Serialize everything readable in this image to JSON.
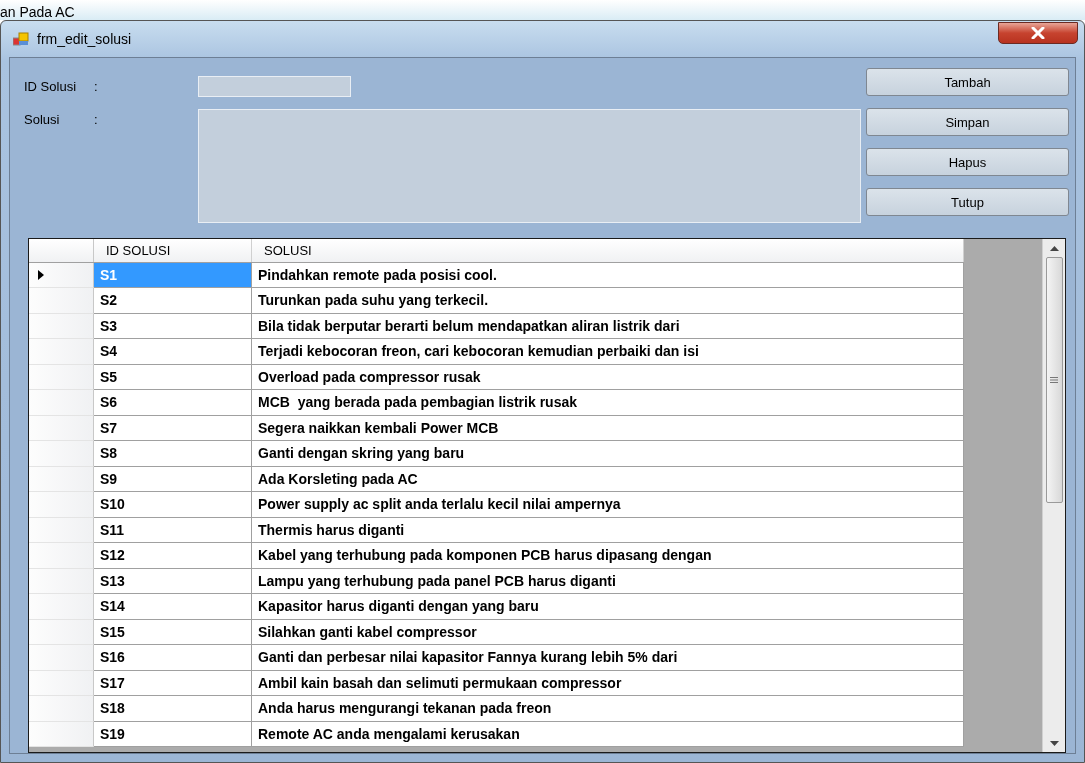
{
  "background_window": {
    "title": "an Pada AC"
  },
  "window": {
    "title": "frm_edit_solusi"
  },
  "form": {
    "fields": [
      {
        "label": "ID Solusi",
        "separator": ":",
        "kind": "text"
      },
      {
        "label": "Solusi",
        "separator": ":",
        "kind": "textarea"
      }
    ]
  },
  "buttons": [
    "Tambah",
    "Simpan",
    "Hapus",
    "Tutup"
  ],
  "table": {
    "columns": [
      "ID SOLUSI",
      "SOLUSI"
    ],
    "rows": [
      {
        "id": "S1",
        "solusi": "Pindahkan remote pada posisi cool.",
        "selected": true
      },
      {
        "id": "S2",
        "solusi": "Turunkan pada suhu yang terkecil.",
        "selected": false
      },
      {
        "id": "S3",
        "solusi": "Bila tidak berputar berarti belum mendapatkan aliran listrik dari",
        "selected": false
      },
      {
        "id": "S4",
        "solusi": "Terjadi kebocoran freon, cari kebocoran kemudian perbaiki dan isi",
        "selected": false
      },
      {
        "id": "S5",
        "solusi": "Overload pada compressor rusak",
        "selected": false
      },
      {
        "id": "S6",
        "solusi": "MCB  yang berada pada pembagian listrik rusak",
        "selected": false
      },
      {
        "id": "S7",
        "solusi": "Segera naikkan kembali Power MCB",
        "selected": false
      },
      {
        "id": "S8",
        "solusi": "Ganti dengan skring yang baru",
        "selected": false
      },
      {
        "id": "S9",
        "solusi": "Ada Korsleting pada AC",
        "selected": false
      },
      {
        "id": "S10",
        "solusi": "Power supply ac split anda terlalu kecil nilai ampernya",
        "selected": false
      },
      {
        "id": "S11",
        "solusi": "Thermis harus diganti",
        "selected": false
      },
      {
        "id": "S12",
        "solusi": "Kabel yang terhubung pada komponen PCB harus dipasang dengan",
        "selected": false
      },
      {
        "id": "S13",
        "solusi": "Lampu yang terhubung pada panel PCB harus diganti",
        "selected": false
      },
      {
        "id": "S14",
        "solusi": "Kapasitor harus diganti dengan yang baru",
        "selected": false
      },
      {
        "id": "S15",
        "solusi": "Silahkan ganti kabel compressor",
        "selected": false
      },
      {
        "id": "S16",
        "solusi": "Ganti dan perbesar nilai kapasitor Fannya kurang lebih 5% dari",
        "selected": false
      },
      {
        "id": "S17",
        "solusi": "Ambil kain basah dan selimuti permukaan compressor",
        "selected": false
      },
      {
        "id": "S18",
        "solusi": "Anda harus mengurangi tekanan pada freon",
        "selected": false
      },
      {
        "id": "S19",
        "solusi": "Remote AC anda mengalami kerusakan",
        "selected": false
      }
    ]
  }
}
